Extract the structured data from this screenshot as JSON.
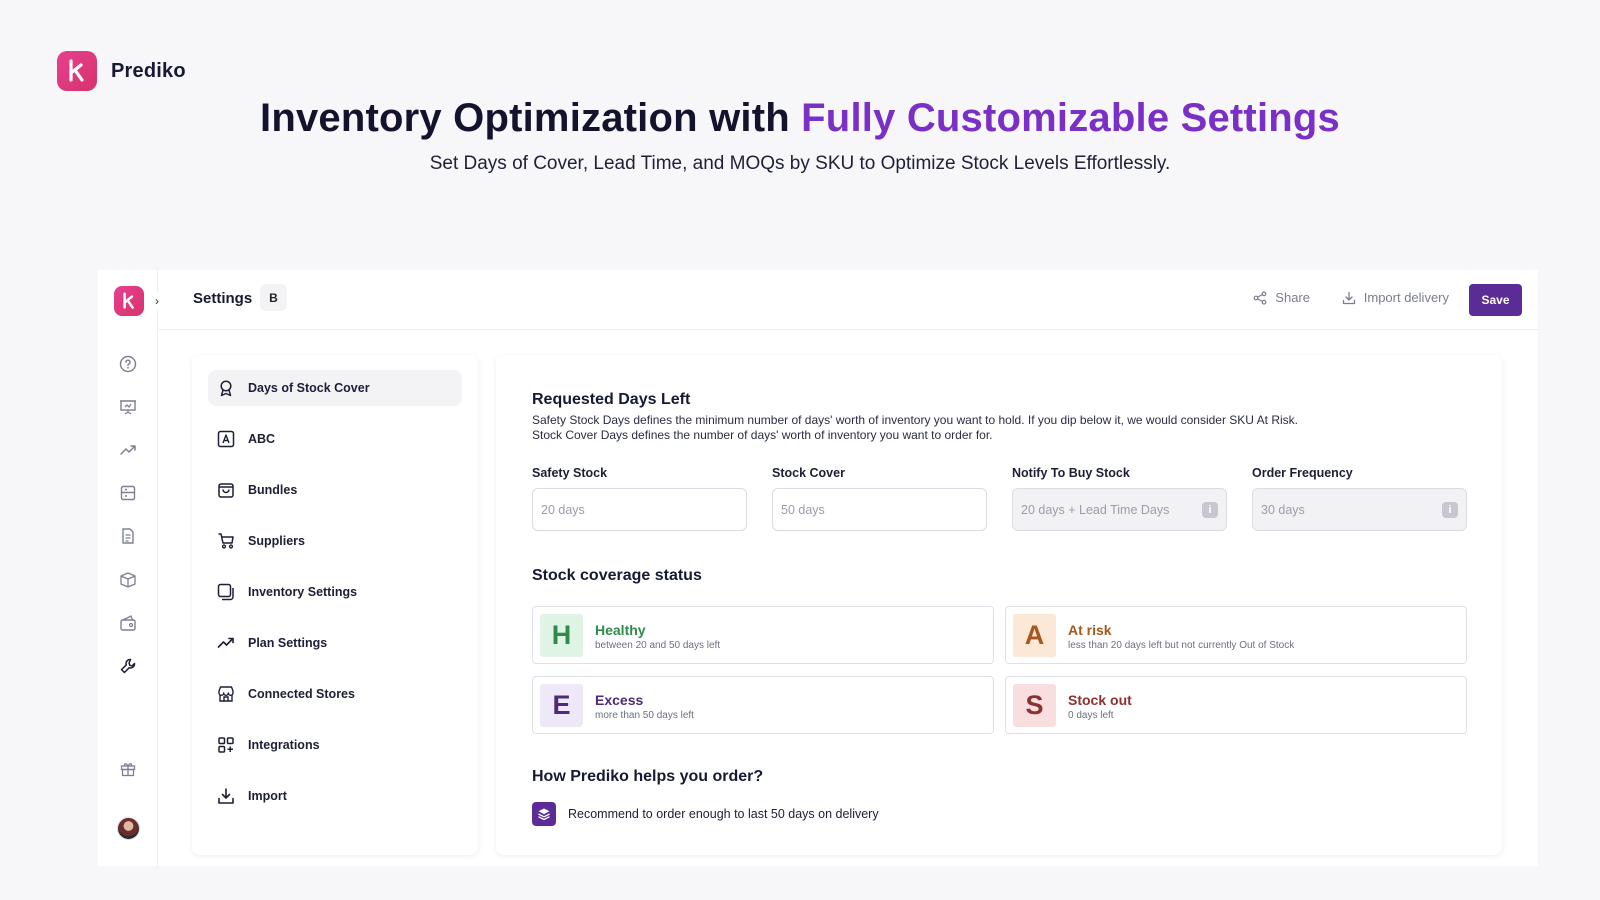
{
  "brand": {
    "name": "Prediko"
  },
  "hero": {
    "title_main": "Inventory Optimization with ",
    "title_accent": "Fully Customizable Settings",
    "subtitle": "Set Days of Cover, Lead Time, and MOQs by SKU to Optimize Stock Levels Effortlessly."
  },
  "topbar": {
    "title": "Settings",
    "badge": "B",
    "share_label": "Share",
    "import_label": "Import delivery",
    "save_label": "Save"
  },
  "rail": {
    "icons": [
      "help-icon",
      "presentation-icon",
      "trend-icon",
      "inventory-icon",
      "document-icon",
      "box-icon",
      "cash-icon",
      "wrench-icon",
      "gift-icon"
    ]
  },
  "nav": {
    "items": [
      {
        "label": "Days of Stock Cover",
        "icon": "award-icon",
        "active": true
      },
      {
        "label": "ABC",
        "icon": "letter-a-icon"
      },
      {
        "label": "Bundles",
        "icon": "bag-icon"
      },
      {
        "label": "Suppliers",
        "icon": "cart-icon"
      },
      {
        "label": "Inventory Settings",
        "icon": "copy-icon"
      },
      {
        "label": "Plan Settings",
        "icon": "trend-icon"
      },
      {
        "label": "Connected Stores",
        "icon": "store-icon"
      },
      {
        "label": "Integrations",
        "icon": "grid-plus-icon"
      },
      {
        "label": "Import",
        "icon": "download-icon"
      }
    ]
  },
  "main": {
    "requested": {
      "title": "Requested Days Left",
      "desc_1": "Safety Stock Days defines the minimum number of days' worth of inventory you want to hold. If you dip below it, we would consider SKU At Risk.",
      "desc_2": "Stock Cover Days defines the number of days' worth of inventory you want to order for."
    },
    "fields": [
      {
        "label": "Safety Stock",
        "placeholder": "20 days",
        "disabled": false
      },
      {
        "label": "Stock Cover",
        "placeholder": "50 days",
        "disabled": false
      },
      {
        "label": "Notify To Buy Stock",
        "placeholder": "20 days + Lead Time Days",
        "disabled": true
      },
      {
        "label": "Order Frequency",
        "placeholder": "30 days",
        "disabled": true
      }
    ],
    "info_glyph": "i",
    "coverage": {
      "title": "Stock coverage status",
      "statuses": [
        {
          "letter": "H",
          "title": "Healthy",
          "desc": "between 20 and 50 days left",
          "color": "#2f8a4c",
          "bg": "#dff4e5"
        },
        {
          "letter": "A",
          "title": "At risk",
          "desc": "less than 20 days left but not currently Out of Stock",
          "color": "#a5591d",
          "bg": "#fbe8d6"
        },
        {
          "letter": "E",
          "title": "Excess",
          "desc": "more than 50 days left",
          "color": "#4d2a7a",
          "bg": "#efe8f8"
        },
        {
          "letter": "S",
          "title": "Stock out",
          "desc": "0 days left",
          "color": "#8e3030",
          "bg": "#f8dede"
        }
      ]
    },
    "helps": {
      "title": "How Prediko helps you order?",
      "text": "Recommend to order enough to last 50 days on delivery"
    }
  },
  "colors": {
    "accent": "#7a2fc6",
    "primary": "#5b2b96",
    "brand_pink": "#e7408f"
  }
}
